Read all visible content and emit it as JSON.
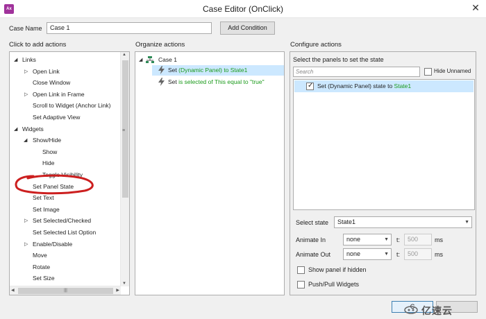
{
  "window": {
    "title": "Case Editor (OnClick)",
    "app_icon": "Ax",
    "close_glyph": "✕"
  },
  "case": {
    "label": "Case Name",
    "value": "Case 1",
    "add_condition": "Add Condition"
  },
  "sections": {
    "click": "Click to add actions",
    "organize": "Organize actions",
    "configure": "Configure actions"
  },
  "actions_tree": [
    {
      "label": "Links",
      "indent": 0,
      "toggle": "open"
    },
    {
      "label": "Open Link",
      "indent": 1,
      "toggle": "closed"
    },
    {
      "label": "Close Window",
      "indent": 1,
      "toggle": ""
    },
    {
      "label": "Open Link in Frame",
      "indent": 1,
      "toggle": "closed"
    },
    {
      "label": "Scroll to Widget (Anchor Link)",
      "indent": 1,
      "toggle": ""
    },
    {
      "label": "Set Adaptive View",
      "indent": 1,
      "toggle": ""
    },
    {
      "label": "Widgets",
      "indent": 0,
      "toggle": "open"
    },
    {
      "label": "Show/Hide",
      "indent": 1,
      "toggle": "open"
    },
    {
      "label": "Show",
      "indent": 2,
      "toggle": ""
    },
    {
      "label": "Hide",
      "indent": 2,
      "toggle": ""
    },
    {
      "label": "Toggle Visibility",
      "indent": 2,
      "toggle": ""
    },
    {
      "label": "Set Panel State",
      "indent": 1,
      "toggle": ""
    },
    {
      "label": "Set Text",
      "indent": 1,
      "toggle": ""
    },
    {
      "label": "Set Image",
      "indent": 1,
      "toggle": ""
    },
    {
      "label": "Set Selected/Checked",
      "indent": 1,
      "toggle": "closed"
    },
    {
      "label": "Set Selected List Option",
      "indent": 1,
      "toggle": ""
    },
    {
      "label": "Enable/Disable",
      "indent": 1,
      "toggle": "closed"
    },
    {
      "label": "Move",
      "indent": 1,
      "toggle": ""
    },
    {
      "label": "Rotate",
      "indent": 1,
      "toggle": ""
    },
    {
      "label": "Set Size",
      "indent": 1,
      "toggle": ""
    }
  ],
  "organize": {
    "case_label": "Case 1",
    "action1": {
      "verb": "Set",
      "detail": " (Dynamic Panel) to State1"
    },
    "action2": {
      "verb": "Set",
      "detail": " is selected of This equal to \"true\""
    }
  },
  "configure": {
    "select_panels_label": "Select the panels to set the state",
    "search_placeholder": "Search",
    "hide_unnamed": "Hide Unnamed",
    "panel_row": {
      "prefix": "Set (Dynamic Panel) state to ",
      "state": "State1",
      "checked": true
    },
    "select_state_label": "Select state",
    "select_state_value": "State1",
    "animate_in_label": "Animate In",
    "animate_in_value": "none",
    "animate_out_label": "Animate Out",
    "animate_out_value": "none",
    "t_label": "t:",
    "t_in": "500",
    "t_out": "500",
    "ms": "ms",
    "show_if_hidden": "Show panel if hidden",
    "push_pull": "Push/Pull Widgets"
  },
  "footer": {
    "ok": "C",
    "watermark": "亿速云"
  },
  "colors": {
    "selection": "#cce8ff",
    "green_text": "#1a9a1a",
    "annotation": "#cc1f1f"
  }
}
